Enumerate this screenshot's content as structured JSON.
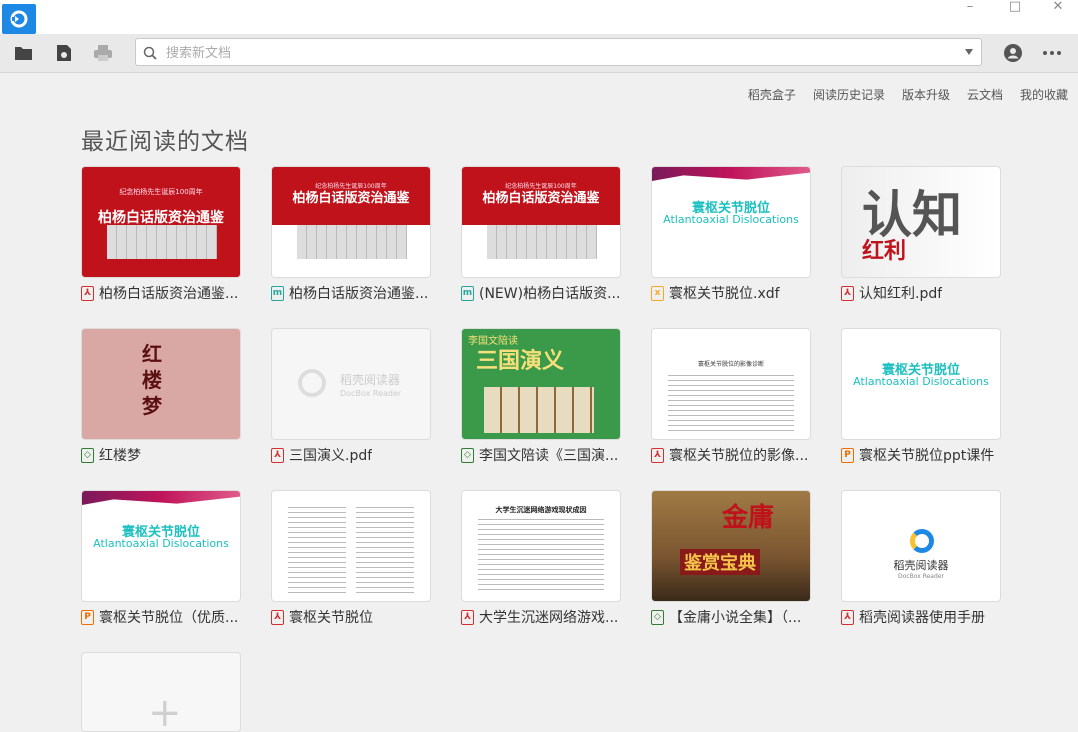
{
  "search": {
    "placeholder": "搜索新文档"
  },
  "top_links": [
    "稻壳盒子",
    "阅读历史记录",
    "版本升级",
    "云文档",
    "我的收藏"
  ],
  "section_title": "最近阅读的文档",
  "colors": {
    "accent": "#1e88e5",
    "pdf": "#d32f2f",
    "mobi": "#26a69a",
    "xdf": "#f9a825",
    "ppt": "#ef6c00",
    "epub": "#2e7d32"
  },
  "documents": [
    {
      "name": "柏杨白话版资治通鉴...",
      "type": "pdf",
      "thumb_title": "柏杨白话版资治通鉴",
      "thumb_sub": "纪念柏杨先生诞辰100周年"
    },
    {
      "name": "柏杨白话版资治通鉴...",
      "type": "mobi",
      "thumb_title": "柏杨白话版资治通鉴",
      "thumb_sub": "纪念柏杨先生诞辰100周年"
    },
    {
      "name": "(NEW)柏杨白话版资...",
      "type": "mobi",
      "thumb_title": "柏杨白话版资治通鉴",
      "thumb_sub": "纪念柏杨先生诞辰100周年"
    },
    {
      "name": "寰枢关节脱位.xdf",
      "type": "xdf",
      "thumb_title": "寰枢关节脱位",
      "thumb_sub": "Atlantoaxial Dislocations"
    },
    {
      "name": "认知红利.pdf",
      "type": "pdf",
      "thumb_title": "认知",
      "thumb_sub": "红利"
    },
    {
      "name": "红楼梦",
      "type": "epub",
      "thumb_title": "红楼梦",
      "thumb_sub": ""
    },
    {
      "name": "三国演义.pdf",
      "type": "pdf",
      "thumb_title": "稻壳阅读器",
      "thumb_sub": "DocBox Reader"
    },
    {
      "name": "李国文陪读《三国演...",
      "type": "epub",
      "thumb_title": "三国演义",
      "thumb_sub": "李国文陪读"
    },
    {
      "name": "寰枢关节脱位的影像...",
      "type": "pdf",
      "thumb_title": "寰枢关节脱位的影像诊断",
      "thumb_sub": ""
    },
    {
      "name": "寰枢关节脱位ppt课件",
      "type": "ppt",
      "thumb_title": "寰枢关节脱位",
      "thumb_sub": "Atlantoaxial Dislocations"
    },
    {
      "name": "寰枢关节脱位（优质...",
      "type": "ppt",
      "thumb_title": "寰枢关节脱位",
      "thumb_sub": "Atlantoaxial Dislocations"
    },
    {
      "name": "寰枢关节脱位",
      "type": "pdf",
      "thumb_title": "",
      "thumb_sub": ""
    },
    {
      "name": "大学生沉迷网络游戏...",
      "type": "pdf",
      "thumb_title": "大学生沉迷网络游戏现状成因",
      "thumb_sub": ""
    },
    {
      "name": "【金庸小说全集】（...",
      "type": "epub",
      "thumb_title": "鉴赏宝典",
      "thumb_sub": "金庸"
    },
    {
      "name": "稻壳阅读器使用手册",
      "type": "pdf",
      "thumb_title": "稻壳阅读器",
      "thumb_sub": "DocBox Reader"
    }
  ],
  "add_tile": {
    "icon": "plus-icon"
  }
}
